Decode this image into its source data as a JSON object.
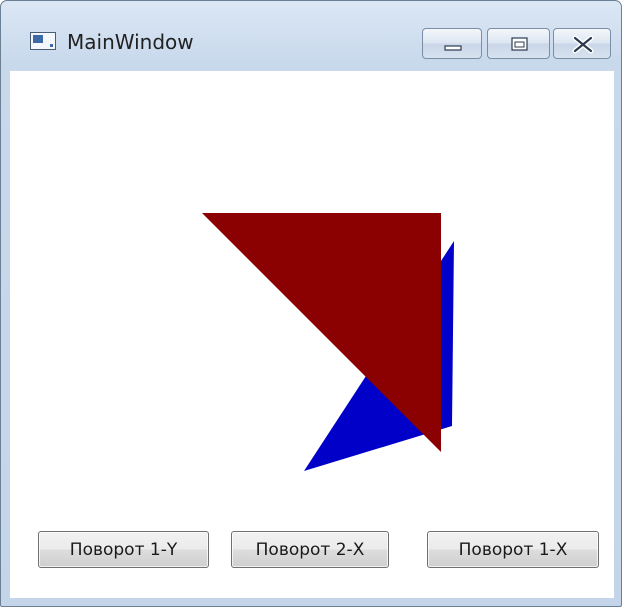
{
  "window": {
    "title": "MainWindow",
    "controls": {
      "minimize_icon": "minimize-icon",
      "maximize_icon": "maximize-icon",
      "close_icon": "close-icon"
    }
  },
  "scene": {
    "shapes": [
      {
        "name": "blue-triangle",
        "color": "#0000c8"
      },
      {
        "name": "red-triangle",
        "color": "#8b0000"
      }
    ]
  },
  "buttons": {
    "rotate_1y": "Поворот 1-Y",
    "rotate_2x": "Поворот 2-X",
    "rotate_1x": "Поворот 1-X"
  },
  "colors": {
    "titlebar": "#c9d9ec",
    "blue_shape": "#0000c8",
    "red_shape": "#8b0000"
  }
}
